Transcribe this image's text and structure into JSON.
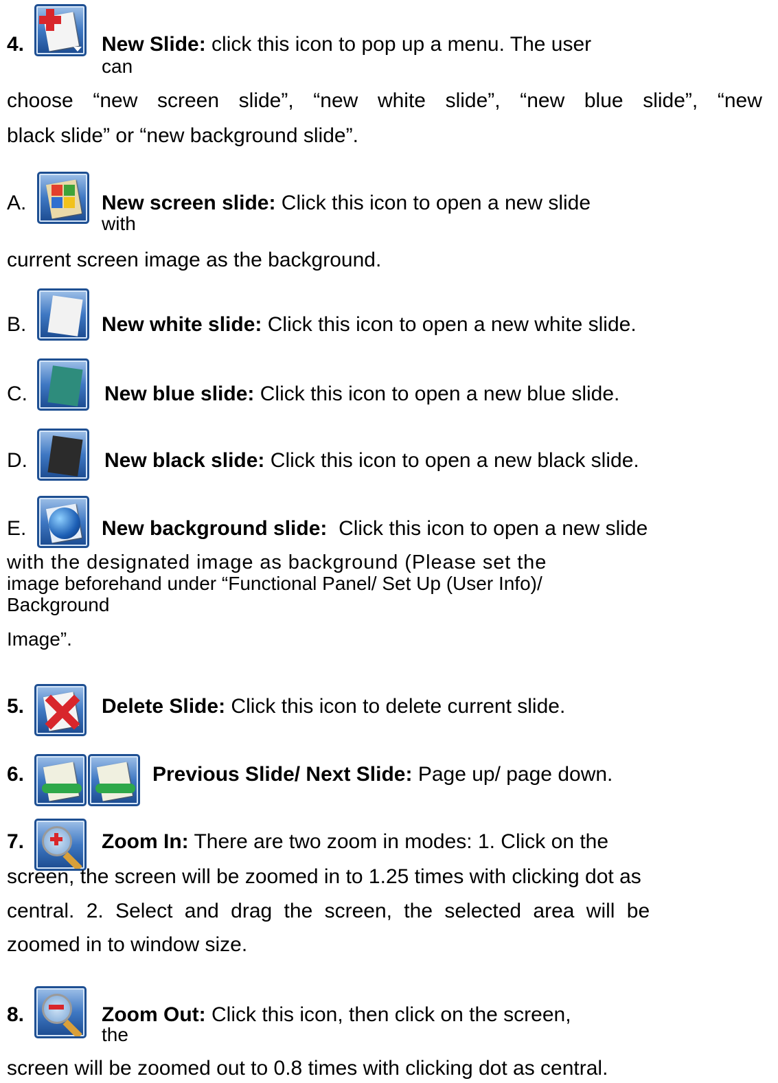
{
  "items": {
    "new_slide": {
      "num": "4.",
      "title": "New Slide:",
      "text1": "click this icon to pop up a menu. The user",
      "text1b": "can",
      "line2": [
        "choose",
        "“new",
        "screen",
        "slide”,",
        "“new",
        "white",
        "slide”,",
        "“new",
        "blue",
        "slide”,",
        "“new"
      ],
      "line3": "black slide” or “new background slide”."
    },
    "screen_slide": {
      "letter": "A.",
      "title": "New screen slide:",
      "text1": "Click this icon to open a new slide",
      "text1b": "with",
      "line2": "current screen image as the background."
    },
    "white_slide": {
      "letter": "B.",
      "title": "New white slide:",
      "text": "Click this icon to open a new white slide."
    },
    "blue_slide": {
      "letter": "C.",
      "title": "New blue slide:",
      "text": "Click this icon to open a new blue slide."
    },
    "black_slide": {
      "letter": "D.",
      "title": "New black slide:",
      "text": "Click this icon to open a new black slide."
    },
    "background_slide": {
      "letter": "E.",
      "title": "New background slide:",
      "text1": "Click this icon to open a new slide",
      "line2": "with the designated image as background (Please set the",
      "line3": "image beforehand under “Functional Panel/ Set Up (User Info)/",
      "line4": "Background",
      "line5": "Image”."
    },
    "delete_slide": {
      "num": "5.",
      "title": "Delete Slide:",
      "text": "Click this icon to delete current slide."
    },
    "prev_next": {
      "num": "6.",
      "title": "Previous Slide/ Next Slide:",
      "text": "Page up/ page down."
    },
    "zoom_in": {
      "num": "7.",
      "title": "Zoom In:",
      "text1": "There are two zoom in modes: 1. Click on the",
      "line2": "screen, the screen will be zoomed in to 1.25 times with clicking dot as",
      "line3": "central. 2. Select and drag the screen, the selected area will be",
      "line4": "zoomed in to window size."
    },
    "zoom_out": {
      "num": "8.",
      "title": "Zoom Out:",
      "text1": "Click this icon, then click on the screen,",
      "text1b": "the",
      "line2": "screen will be zoomed out to 0.8 times with clicking dot as central."
    }
  },
  "icons": {
    "new_slide": "new-slide-icon",
    "new_screen_slide": "screen-slide-icon",
    "new_white_slide": "white-slide-icon",
    "new_blue_slide": "blue-slide-icon",
    "new_black_slide": "black-slide-icon",
    "new_background_slide": "globe-icon",
    "delete_slide": "delete-slide-icon",
    "previous_slide": "previous-slide-icon",
    "next_slide": "next-slide-icon",
    "zoom_in": "zoom-in-icon",
    "zoom_out": "zoom-out-icon"
  },
  "colors": {
    "icon_frame": "#1e4f92",
    "delete_red": "#d8262b",
    "blue_slide": "#2e8c7c",
    "black_slide": "#2b2b2b"
  }
}
